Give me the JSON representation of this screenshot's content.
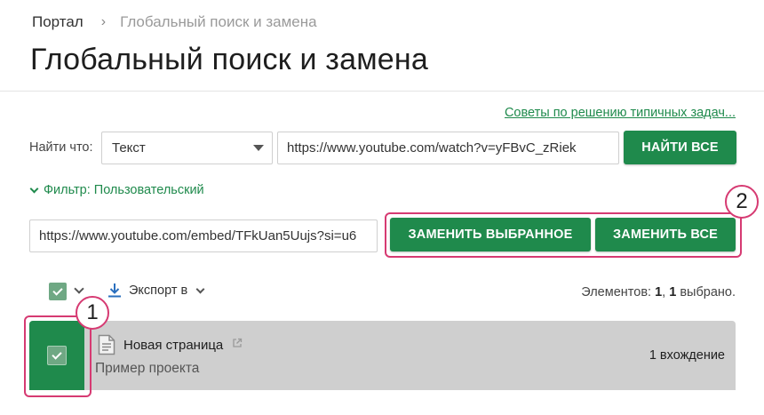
{
  "breadcrumb": {
    "home": "Портал",
    "separator": "›",
    "current": "Глобальный поиск и замена"
  },
  "page": {
    "title": "Глобальный поиск и замена"
  },
  "tips_link": "Советы по решению типичных задач...",
  "search": {
    "label": "Найти что:",
    "type_selected": "Текст",
    "find_value": "https://www.youtube.com/watch?v=yFBvC_zRiek",
    "find_all_label": "НАЙТИ ВСЕ"
  },
  "filter": {
    "label": "Фильтр: Пользовательский"
  },
  "replace": {
    "value": "https://www.youtube.com/embed/TFkUan5Uujs?si=u6",
    "replace_selected_label": "ЗАМЕНИТЬ ВЫБРАННОЕ",
    "replace_all_label": "ЗАМЕНИТЬ ВСЕ"
  },
  "toolbar": {
    "export_label": "Экспорт в",
    "count_prefix": "Элементов: ",
    "count_total": "1",
    "count_sep": ", ",
    "count_selected": "1",
    "count_suffix": " выбрано."
  },
  "results": [
    {
      "title": "Новая страница",
      "project": "Пример проекта",
      "occurrences": "1 вхождение",
      "selected": true
    }
  ],
  "annotations": {
    "badge_1": "1",
    "badge_2": "2"
  },
  "colors": {
    "accent": "#1f8a4c",
    "highlight": "#d63a72",
    "row_bg": "#cfcfcf",
    "checkbox": "#6fa884"
  },
  "icons": {
    "download": "download-icon",
    "document": "document-icon",
    "external": "external-link-icon",
    "check": "check-icon"
  }
}
